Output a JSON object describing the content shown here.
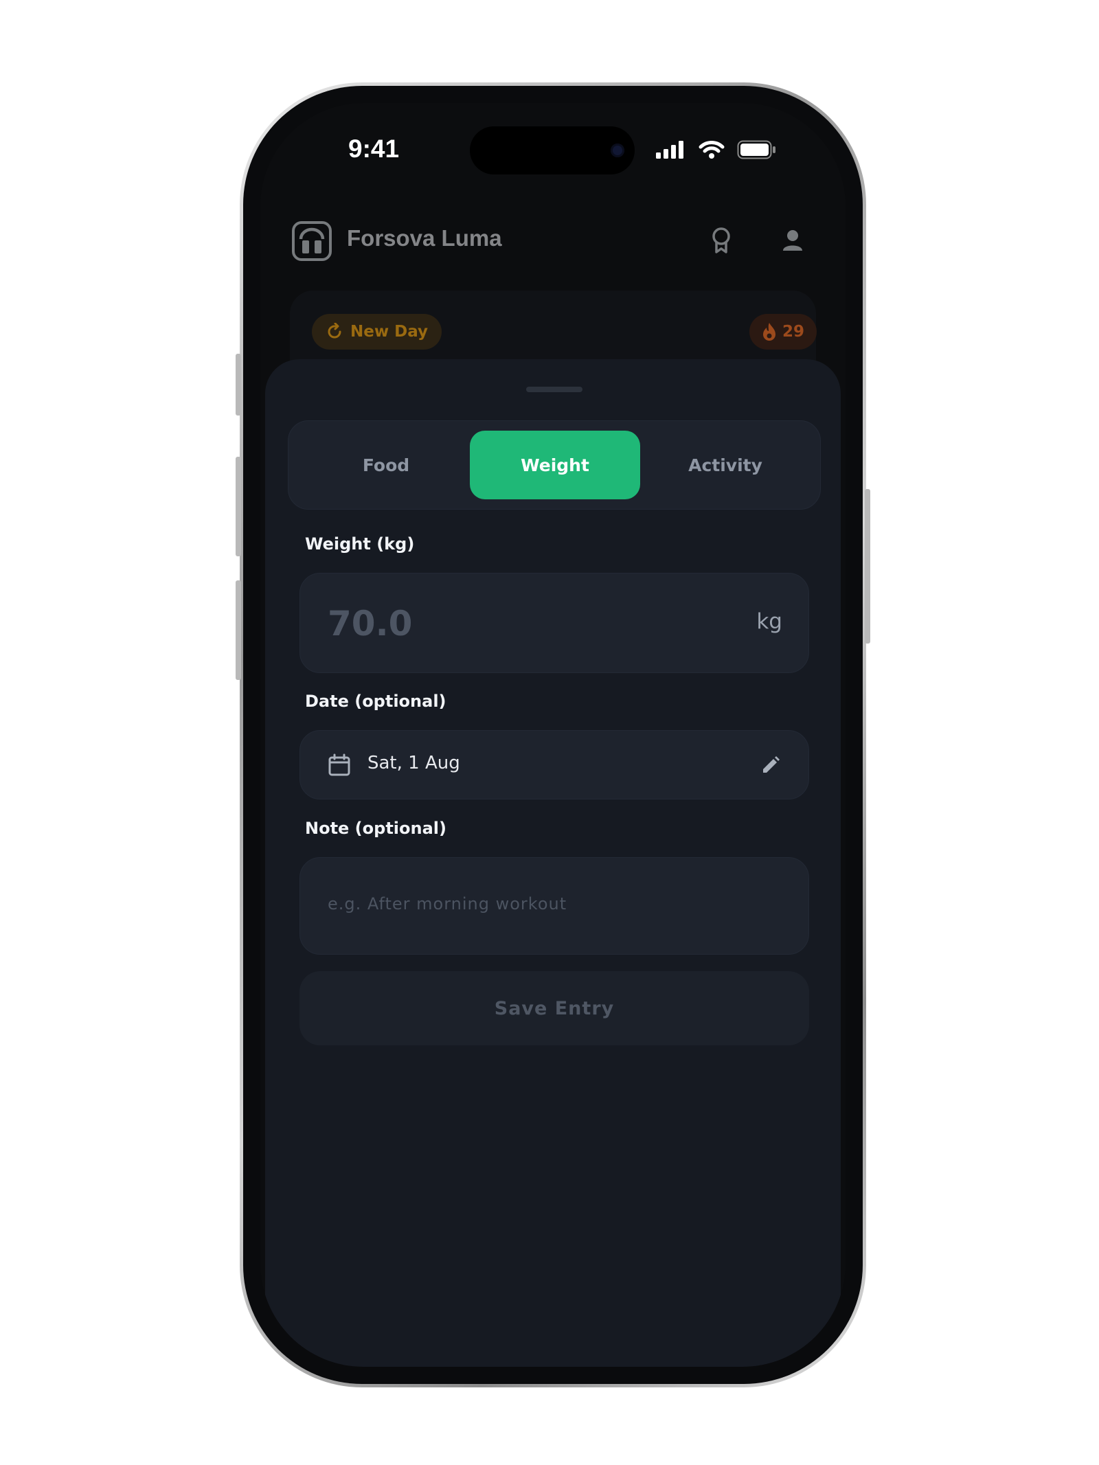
{
  "status_bar": {
    "time": "9:41"
  },
  "app": {
    "name": "Forsova Luma"
  },
  "banner": {
    "new_day_label": "New Day",
    "streak_count": "29"
  },
  "tabs": [
    {
      "label": "Food",
      "active": false
    },
    {
      "label": "Weight",
      "active": true
    },
    {
      "label": "Activity",
      "active": false
    }
  ],
  "weight": {
    "label": "Weight (kg)",
    "placeholder": "70.0",
    "unit": "kg"
  },
  "date": {
    "label": "Date (optional)",
    "value": "Sat, 1 Aug"
  },
  "note": {
    "label": "Note (optional)",
    "placeholder": "e.g. After morning workout"
  },
  "save": {
    "label": "Save Entry"
  },
  "colors": {
    "accent": "#1fb877",
    "sheet": "#161a22",
    "field": "#1e232d",
    "new_day": "#9a6a10",
    "streak": "#9c4a1c"
  },
  "icons": [
    "signal-icon",
    "wifi-icon",
    "battery-icon",
    "app-logo-icon",
    "award-icon",
    "profile-icon",
    "refresh-icon",
    "flame-icon",
    "calendar-icon",
    "pencil-icon"
  ]
}
